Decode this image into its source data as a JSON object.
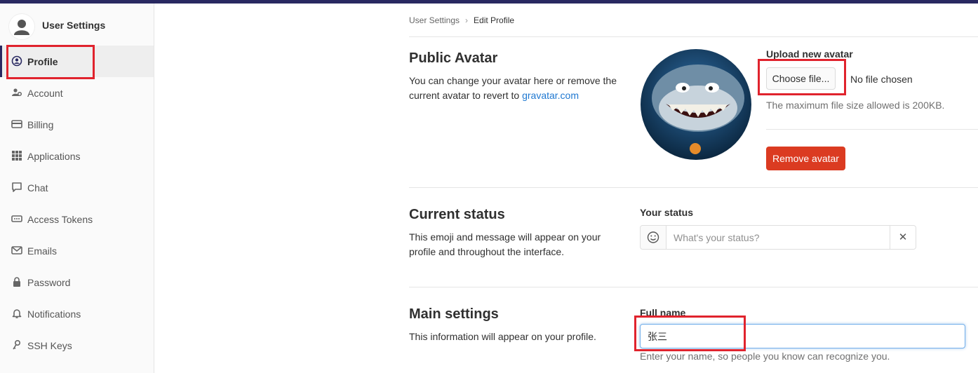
{
  "sidebar": {
    "title": "User Settings",
    "items": [
      {
        "label": "Profile",
        "icon": "profile-icon",
        "active": true
      },
      {
        "label": "Account",
        "icon": "account-icon"
      },
      {
        "label": "Billing",
        "icon": "credit-card-icon"
      },
      {
        "label": "Applications",
        "icon": "grid-icon"
      },
      {
        "label": "Chat",
        "icon": "chat-icon"
      },
      {
        "label": "Access Tokens",
        "icon": "token-icon"
      },
      {
        "label": "Emails",
        "icon": "mail-icon"
      },
      {
        "label": "Password",
        "icon": "lock-icon"
      },
      {
        "label": "Notifications",
        "icon": "bell-icon"
      },
      {
        "label": "SSH Keys",
        "icon": "key-icon"
      }
    ]
  },
  "breadcrumb": {
    "parent": "User Settings",
    "current": "Edit Profile"
  },
  "avatar_section": {
    "title": "Public Avatar",
    "desc_text": "You can change your avatar here or remove the current avatar to revert to ",
    "desc_link": "gravatar.com",
    "upload_label": "Upload new avatar",
    "choose_button": "Choose file...",
    "no_file": "No file chosen",
    "help": "The maximum file size allowed is 200KB.",
    "remove_button": "Remove avatar"
  },
  "status_section": {
    "title": "Current status",
    "desc": "This emoji and message will appear on your profile and throughout the interface.",
    "label": "Your status",
    "placeholder": "What's your status?",
    "clear": "✕"
  },
  "main_section": {
    "title": "Main settings",
    "desc": "This information will appear on your profile.",
    "fullname_label": "Full name",
    "fullname_value": "张三",
    "fullname_help": "Enter your name, so people you know can recognize you."
  },
  "colors": {
    "accent": "#292961",
    "danger": "#db3b21",
    "link": "#1f78d1",
    "highlight": "#e0232d"
  }
}
